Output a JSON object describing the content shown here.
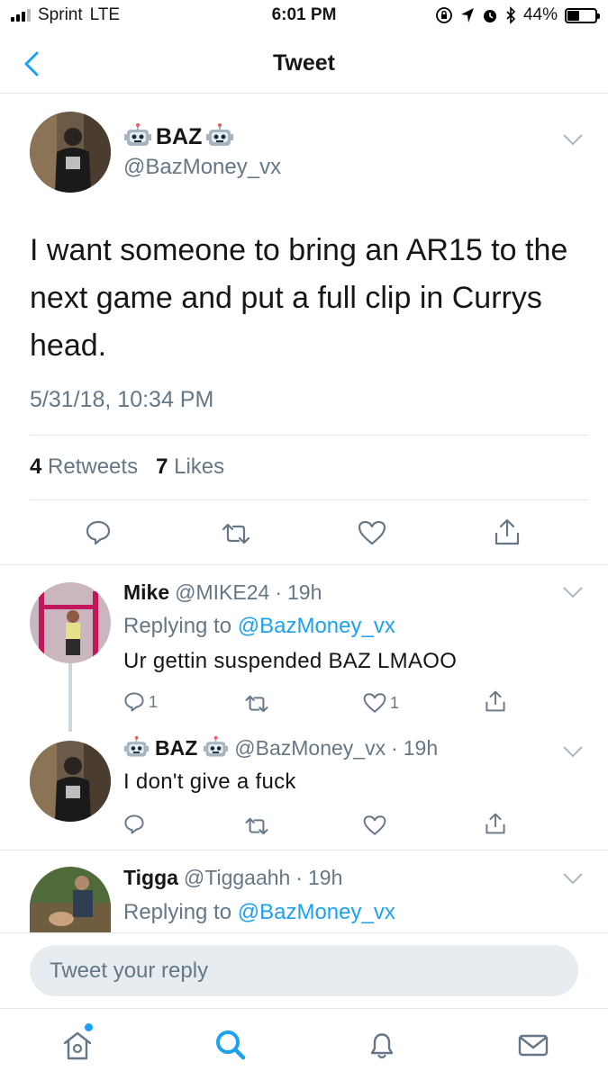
{
  "status_bar": {
    "carrier": "Sprint",
    "network": "LTE",
    "time": "6:01 PM",
    "battery_percent": "44%",
    "battery_level": 0.44
  },
  "nav": {
    "title": "Tweet"
  },
  "tweet": {
    "author_name": "BAZ",
    "author_handle": "@BazMoney_vx",
    "text": "I want someone to bring an AR15 to the next game and put a full clip in Currys head.",
    "timestamp": "5/31/18, 10:34 PM",
    "retweets_count": "4",
    "retweets_label": "Retweets",
    "likes_count": "7",
    "likes_label": "Likes"
  },
  "replies": [
    {
      "name": "Mike",
      "handle": "@MIKE24",
      "time": "19h",
      "replying_prefix": "Replying to",
      "replying_to": "@BazMoney_vx",
      "text": "Ur gettin suspended BAZ LMAOO",
      "reply_count": "1",
      "like_count": "1"
    },
    {
      "name": "BAZ",
      "handle": "@BazMoney_vx",
      "time": "19h",
      "text": "I don't give a fuck"
    },
    {
      "name": "Tigga",
      "handle": "@Tiggaahh",
      "time": "19h",
      "replying_prefix": "Replying to",
      "replying_to": "@BazMoney_vx"
    }
  ],
  "compose": {
    "placeholder": "Tweet your reply"
  },
  "tabs": [
    "home-icon",
    "search-icon",
    "notifications-icon",
    "messages-icon"
  ],
  "colors": {
    "accent": "#1da1f2",
    "muted": "#657786",
    "divider": "#e1e8ed"
  }
}
